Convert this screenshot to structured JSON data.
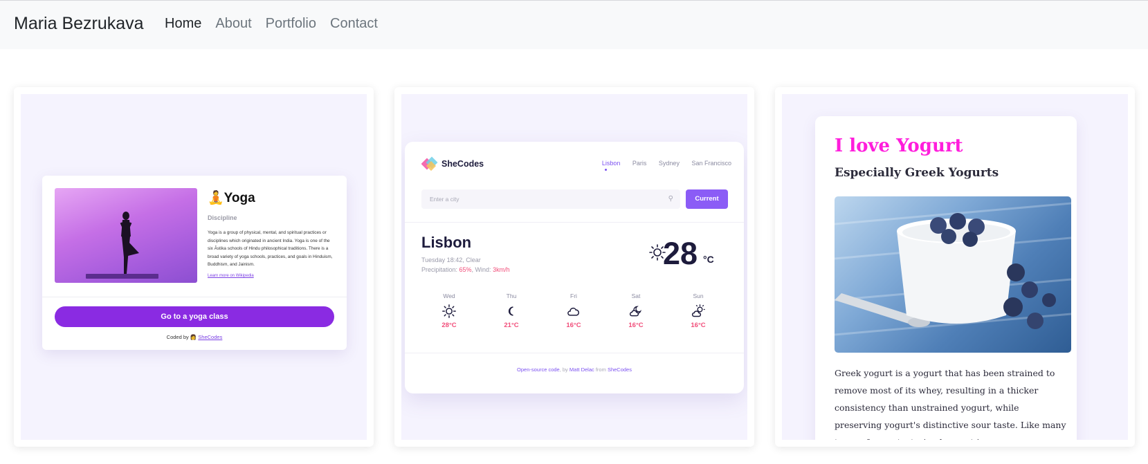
{
  "navbar": {
    "brand": "Maria Bezrukava",
    "links": [
      {
        "label": "Home"
      },
      {
        "label": "About"
      },
      {
        "label": "Portfolio"
      },
      {
        "label": "Contact"
      }
    ]
  },
  "yoga": {
    "title": "🧘Yoga",
    "subtitle": "Discipline",
    "description": "Yoga is a group of physical, mental, and spiritual practices or disciplines which originated in ancient India. Yoga is one of the six Āstika schools of Hindu philosophical traditions. There is a broad variety of yoga schools, practices, and goals in Hinduism, Buddhism, and Jainism.",
    "link": "Learn more on Wikipedia",
    "button": "Go to a yoga class",
    "coded_by": "Coded by 👩",
    "coded_by_link": "SheCodes"
  },
  "weather": {
    "logo_text": "SheCodes",
    "cities": [
      "Lisbon",
      "Paris",
      "Sydney",
      "San Francisco"
    ],
    "search_placeholder": "Enter a city",
    "current_button": "Current",
    "city": "Lisbon",
    "datetime": "Tuesday 18:42, Clear",
    "precip_label": "Precipitation: ",
    "precip_value": "65%",
    "wind_label": ", Wind: ",
    "wind_value": "3km/h",
    "temperature": "28",
    "unit": "°C",
    "forecast": [
      {
        "day": "Wed",
        "temp": "28°C",
        "icon": "sun-icon"
      },
      {
        "day": "Thu",
        "temp": "21°C",
        "icon": "moon-icon"
      },
      {
        "day": "Fri",
        "temp": "16°C",
        "icon": "cloud-icon"
      },
      {
        "day": "Sat",
        "temp": "16°C",
        "icon": "cloud-moon-icon"
      },
      {
        "day": "Sun",
        "temp": "16°C",
        "icon": "cloud-sun-icon"
      }
    ],
    "footer_code": "Open-source code",
    "footer_by": ", by ",
    "footer_author": "Matt Delac",
    "footer_from": " from ",
    "footer_org": "SheCodes"
  },
  "yogurt": {
    "title": "I love Yogurt",
    "subtitle": "Especially Greek Yogurts",
    "text": "Greek yogurt is a yogurt that has been strained to remove most of its whey, resulting in a thicker consistency than unstrained yogurt, while preserving yogurt's distinctive sour taste. Like many types of yogurt, strained yogurt is"
  },
  "colors": {
    "accent_purple": "#8a2be2",
    "weather_purple": "#8b5cf6",
    "pink": "#f14e7a",
    "yogurt_magenta": "#ff1ddc"
  }
}
